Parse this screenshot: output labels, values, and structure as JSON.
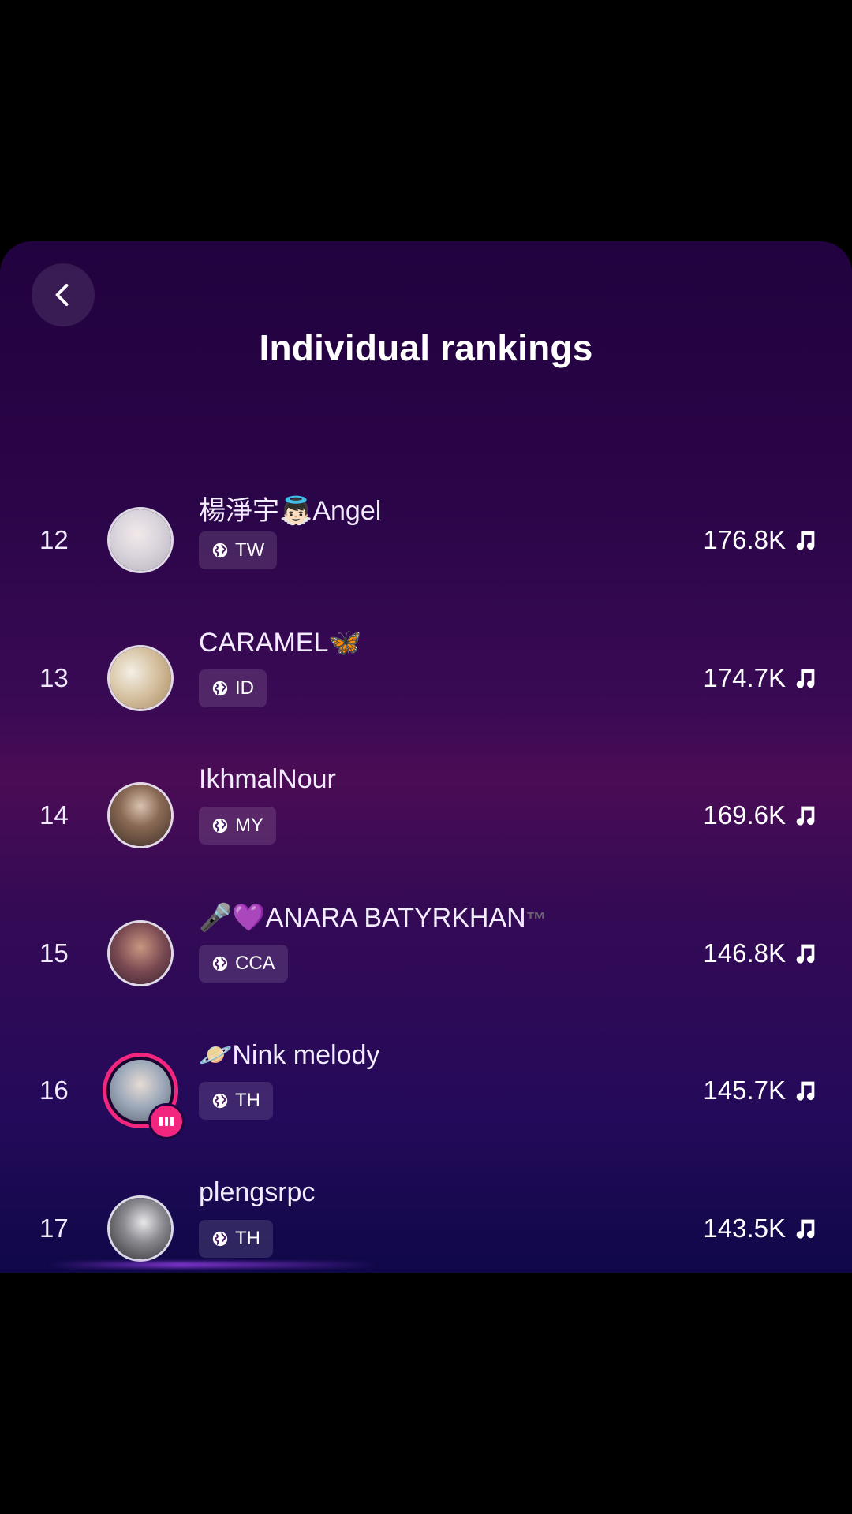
{
  "page": {
    "title": "Individual rankings"
  },
  "rankings": [
    {
      "rank": "12",
      "name": "楊淨宇👼🏻Angel",
      "region": "TW",
      "score": "176.8K",
      "avatar_color": "#d9d4dc",
      "live": false
    },
    {
      "rank": "13",
      "name": "CARAMEL🦋",
      "region": "ID",
      "score": "174.7K",
      "avatar_color": "#c9b79a",
      "live": false
    },
    {
      "rank": "14",
      "name": "IkhmalNour",
      "region": "MY",
      "score": "169.6K",
      "avatar_color": "#6a5140",
      "live": false
    },
    {
      "rank": "15",
      "name": "🎤💜ANARA BATYRKHAN",
      "name_suffix": "™",
      "region": "CCA",
      "score": "146.8K",
      "avatar_color": "#7a4a52",
      "live": false
    },
    {
      "rank": "16",
      "name": "🪐Nink melody",
      "region": "TH",
      "score": "145.7K",
      "avatar_color": "#9aa6b8",
      "live": true
    },
    {
      "rank": "17",
      "name": "plengsrpc",
      "region": "TH",
      "score": "143.5K",
      "avatar_color": "#4a4a4e",
      "live": false
    }
  ],
  "icons": {
    "back": "chevron-left-icon",
    "region": "globe-icon",
    "score": "music-note-icon",
    "live": "live-bars-icon"
  }
}
